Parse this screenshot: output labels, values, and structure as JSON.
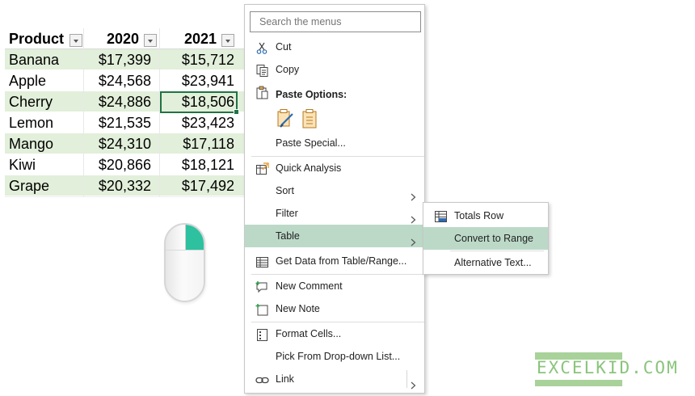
{
  "table": {
    "headers": [
      "Product",
      "2020",
      "2021"
    ],
    "rows": [
      [
        "Banana",
        "$17,399",
        "$15,712"
      ],
      [
        "Apple",
        "$24,568",
        "$23,941"
      ],
      [
        "Cherry",
        "$24,886",
        "$18,506"
      ],
      [
        "Lemon",
        "$21,535",
        "$23,423"
      ],
      [
        "Mango",
        "$24,310",
        "$17,118"
      ],
      [
        "Kiwi",
        "$20,866",
        "$18,121"
      ],
      [
        "Grape",
        "$20,332",
        "$17,492"
      ]
    ],
    "selected_cell_value": "$18,506",
    "band_color": "#e2efda",
    "selection_color": "#217346"
  },
  "context_menu": {
    "search_placeholder": "Search the menus",
    "cut": "Cut",
    "copy": "Copy",
    "paste_options": "Paste Options:",
    "paste_special": "Paste Special...",
    "quick_analysis": "Quick Analysis",
    "sort": "Sort",
    "filter": "Filter",
    "table": "Table",
    "get_data": "Get Data from Table/Range...",
    "new_comment": "New Comment",
    "new_note": "New Note",
    "format_cells": "Format Cells...",
    "pick_dropdown": "Pick From Drop-down List...",
    "link": "Link",
    "highlight_color": "#bcd9c8"
  },
  "table_submenu": {
    "totals_row": "Totals Row",
    "convert_to_range": "Convert to Range",
    "alternative_text": "Alternative Text..."
  },
  "mouse": {
    "pressed_button": "right",
    "accent_color": "#2dc1a0"
  },
  "watermark": {
    "text": "EXCELKID.COM"
  }
}
